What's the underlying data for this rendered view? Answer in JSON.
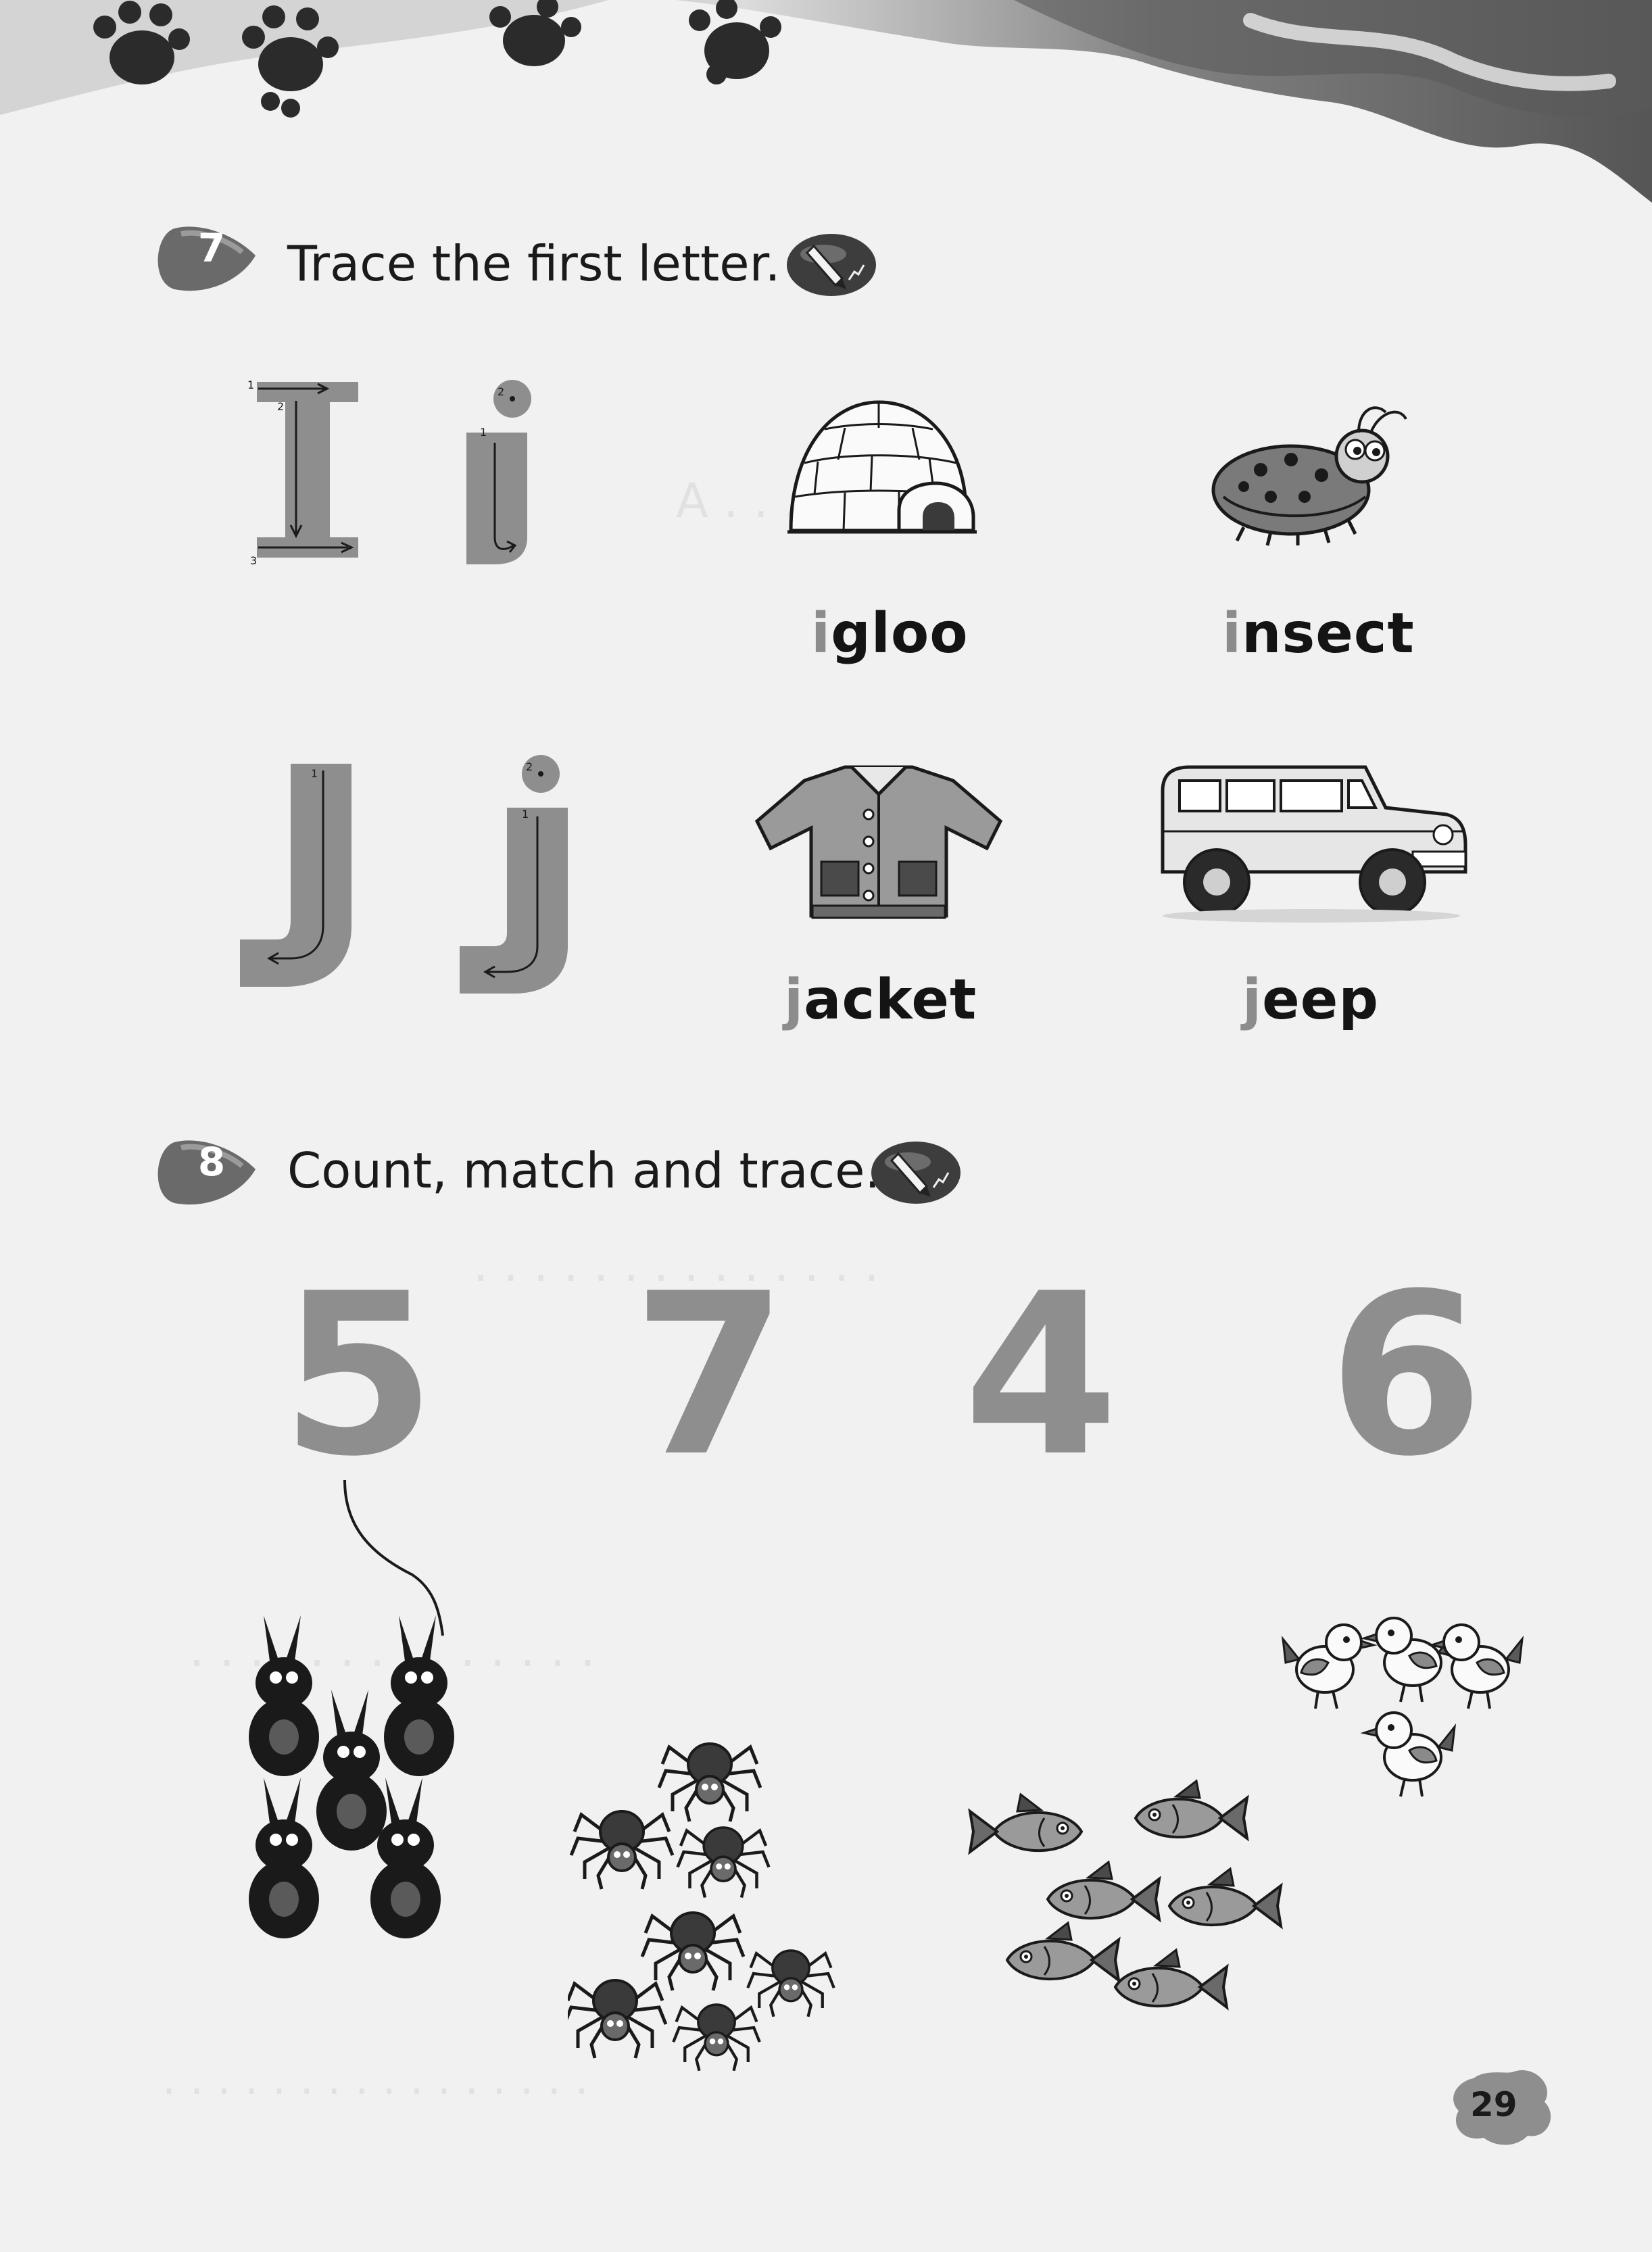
{
  "exercise7": {
    "number": "7",
    "instruction": "Trace the first letter.",
    "pencil_icon": "pencil-icon",
    "letters": [
      {
        "upper": "I",
        "lower": "i"
      },
      {
        "upper": "J",
        "lower": "j"
      }
    ],
    "words": [
      {
        "first": "i",
        "rest": "gloo",
        "picture": "igloo"
      },
      {
        "first": "i",
        "rest": "nsect",
        "picture": "ladybug"
      },
      {
        "first": "j",
        "rest": "acket",
        "picture": "jacket"
      },
      {
        "first": "j",
        "rest": "eep",
        "picture": "jeep"
      }
    ]
  },
  "exercise8": {
    "number": "8",
    "instruction": "Count, match and trace.",
    "pencil_icon": "pencil-icon",
    "numbers": [
      "5",
      "7",
      "4",
      "6"
    ],
    "groups": [
      {
        "animal": "rabbits",
        "count": 5
      },
      {
        "animal": "spiders",
        "count": 7
      },
      {
        "animal": "fish",
        "count": 6
      },
      {
        "animal": "birds",
        "count": 4
      }
    ]
  },
  "page_number": "29",
  "colors": {
    "paper": "#f1f1f1",
    "trace_grey": "#8e8e8e",
    "ink": "#1a1a1a"
  }
}
